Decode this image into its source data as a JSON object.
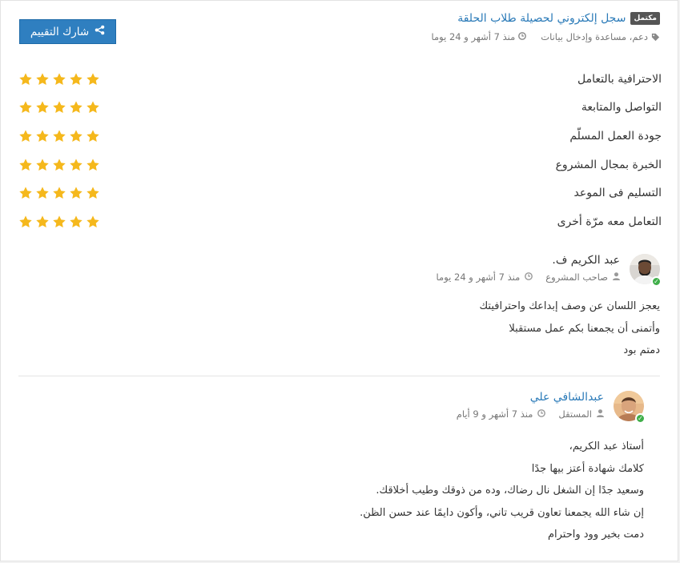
{
  "header": {
    "badge": "مكتمل",
    "title": "سجل إلكتروني لحصيلة طلاب الحلقة",
    "category": "دعم، مساعدة وإدخال بيانات",
    "time": "منذ 7 أشهر و 24 يوما"
  },
  "share_button": {
    "label": "شارك التقييم"
  },
  "colors": {
    "accent": "#2a7ab8",
    "button": "#2f7fc0",
    "star": "#f5b81c",
    "verified": "#3fae49"
  },
  "ratings": [
    {
      "label": "الاحترافية بالتعامل",
      "stars": 5
    },
    {
      "label": "التواصل والمتابعة",
      "stars": 5
    },
    {
      "label": "جودة العمل المسلّم",
      "stars": 5
    },
    {
      "label": "الخبرة بمجال المشروع",
      "stars": 5
    },
    {
      "label": "التسليم فى الموعد",
      "stars": 5
    },
    {
      "label": "التعامل معه مرّة أخرى",
      "stars": 5
    }
  ],
  "comments": [
    {
      "name": "عبد الكريم ف.",
      "role": "صاحب المشروع",
      "time": "منذ 7 أشهر و 24 يوما",
      "lines": [
        "يعجز اللسان عن وصف إبداعك واحترافيتك",
        "وأتمنى أن يجمعنا بكم عمل مستقبلا",
        "دمتم بود"
      ]
    },
    {
      "name": "عبدالشافي علي",
      "role": "المستقل",
      "time": "منذ 7 أشهر و 9 أيام",
      "lines": [
        "أستاذ عبد الكريم،",
        "كلامك شهادة أعتز بيها جدًا",
        "وسعيد جدًا إن الشغل نال رضاك، وده من ذوقك وطيب أخلاقك.",
        "إن شاء الله يجمعنا تعاون قريب تاني، وأكون دايمًا عند حسن الظن.",
        "دمت بخير وود واحترام"
      ]
    }
  ]
}
